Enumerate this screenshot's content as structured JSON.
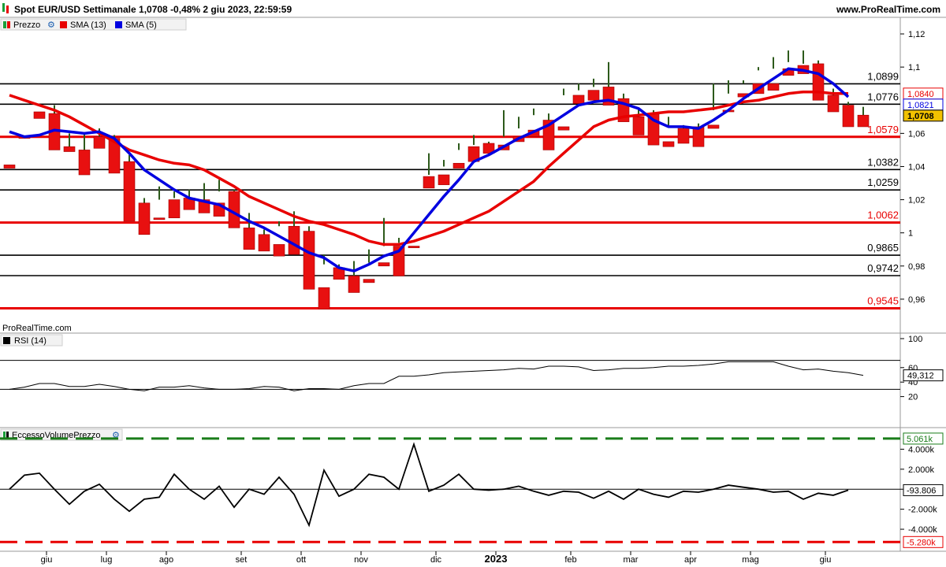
{
  "header": {
    "title": "Spot EUR/USD Settimanale 1,0708 -0,48% 2 giu 2023, 22:59:59",
    "site": "www.ProRealTime.com"
  },
  "price_panel": {
    "legend": [
      {
        "label": "Prezzo",
        "color": "#1a9e3a",
        "icon": "candles-icon"
      },
      {
        "label": "SMA (13)",
        "color": "#e80000"
      },
      {
        "label": "SMA (5)",
        "color": "#0000e0"
      }
    ],
    "watermark": "ProRealTime.com",
    "price_badges": [
      {
        "text": "1,0840",
        "value": 1.084,
        "color": "#e80000"
      },
      {
        "text": "1,0821",
        "value": 1.0821,
        "color": "#0000e0"
      },
      {
        "text": "1,0708",
        "value": 1.0708,
        "color": "#000000",
        "fill": "#f2c200"
      }
    ]
  },
  "rsi_panel": {
    "title": "RSI (14)",
    "value_label": "49,312",
    "value": 49.312,
    "levels": [
      70,
      30
    ],
    "axis": {
      "ticks": [
        20,
        40,
        60,
        100
      ],
      "labels": [
        "20",
        "40",
        "60",
        "100"
      ]
    },
    "series": [
      30,
      33,
      38,
      38,
      34,
      34,
      37,
      34,
      30,
      28,
      33,
      33,
      35,
      32,
      30,
      30,
      31,
      34,
      33,
      28,
      31,
      31,
      30,
      35,
      38,
      38,
      48,
      48,
      50,
      53,
      54,
      55,
      56,
      57,
      59,
      58,
      62,
      62,
      61,
      56,
      57,
      59,
      59,
      60,
      62,
      62,
      63,
      65,
      68,
      68,
      68,
      68,
      62,
      57,
      58,
      55,
      53,
      49.3
    ]
  },
  "volume_panel": {
    "title": "EccessoVolumePrezzo",
    "labels": {
      "top": "5.061k",
      "bottom": "-5.280k",
      "current": "-93.806"
    },
    "levels": {
      "top": 5061,
      "bottom": -5280
    },
    "axis": {
      "ticks": [
        4000,
        2000,
        0,
        -2000,
        -4000
      ],
      "labels": [
        "4.000k",
        "2.000k",
        "0",
        "-2.000k",
        "-4.000k"
      ]
    },
    "series": [
      0,
      1400,
      1600,
      0,
      -1500,
      -200,
      500,
      -1000,
      -2200,
      -1000,
      -800,
      1500,
      0,
      -1000,
      300,
      -1800,
      0,
      -500,
      1200,
      -500,
      -3600,
      1900,
      -700,
      0,
      1500,
      1200,
      0,
      4500,
      -200,
      400,
      1500,
      0,
      -100,
      0,
      300,
      -200,
      -600,
      -200,
      -300,
      -900,
      -200,
      -1000,
      0,
      -500,
      -800,
      -200,
      -300,
      0,
      400,
      200,
      0,
      -300,
      -200,
      -1000,
      -400,
      -600,
      -94
    ]
  },
  "chart_data": {
    "type": "candlestick",
    "title": "Spot EUR/USD Settimanale 1,0708 -0,48% 2 giu 2023, 22:59:59",
    "timeframe": "Settimanale",
    "instrument": "Spot EUR/USD",
    "last": 1.0708,
    "change": "-0,48%",
    "ylim": [
      0.94,
      1.13
    ],
    "y_ticks": [
      0.96,
      0.98,
      1.0,
      1.02,
      1.04,
      1.06,
      1.1,
      1.12
    ],
    "y_tick_labels": [
      "0,96",
      "0,98",
      "1",
      "1,02",
      "1,04",
      "1,06",
      "1,1",
      "1,12"
    ],
    "x_month_labels": [
      {
        "label": "giu",
        "index": 2
      },
      {
        "label": "lug",
        "index": 6
      },
      {
        "label": "ago",
        "index": 10
      },
      {
        "label": "set",
        "index": 15
      },
      {
        "label": "ott",
        "index": 19
      },
      {
        "label": "nov",
        "index": 23
      },
      {
        "label": "dic",
        "index": 28
      },
      {
        "label": "2023",
        "index": 32
      },
      {
        "label": "feb",
        "index": 37
      },
      {
        "label": "mar",
        "index": 41
      },
      {
        "label": "apr",
        "index": 45
      },
      {
        "label": "mag",
        "index": 49
      },
      {
        "label": "giu",
        "index": 54
      }
    ],
    "horizontal_levels": [
      {
        "value": 1.0899,
        "label": "1,0899",
        "color": "#000000"
      },
      {
        "value": 1.0776,
        "label": "1,0776",
        "color": "#000000"
      },
      {
        "value": 1.0579,
        "label": "1,0579",
        "color": "#e80000"
      },
      {
        "value": 1.0382,
        "label": "1,0382",
        "color": "#000000"
      },
      {
        "value": 1.0259,
        "label": "1,0259",
        "color": "#000000"
      },
      {
        "value": 1.0062,
        "label": "1,0062",
        "color": "#e80000"
      },
      {
        "value": 0.9865,
        "label": "0,9865",
        "color": "#000000"
      },
      {
        "value": 0.9742,
        "label": "0,9742",
        "color": "#000000"
      },
      {
        "value": 0.9545,
        "label": "0,9545",
        "color": "#e80000"
      }
    ],
    "candles": [
      [
        1.041,
        1.06,
        1.06,
        1.039
      ],
      [
        1.058,
        1.075,
        1.075,
        1.057
      ],
      [
        1.073,
        1.078,
        1.078,
        1.069
      ],
      [
        1.072,
        1.077,
        1.052,
        1.05
      ],
      [
        1.052,
        1.06,
        1.05,
        1.049
      ],
      [
        1.05,
        1.06,
        1.036,
        1.035
      ],
      [
        1.058,
        1.063,
        1.056,
        1.051
      ],
      [
        1.057,
        1.059,
        1.043,
        1.036
      ],
      [
        1.043,
        1.047,
        1.017,
        1.007
      ],
      [
        1.018,
        1.021,
        1.009,
        0.999
      ],
      [
        1.009,
        1.028,
        1.02,
        1.008
      ],
      [
        1.02,
        1.025,
        1.021,
        1.009
      ],
      [
        1.021,
        1.026,
        1.02,
        1.014
      ],
      [
        1.02,
        1.03,
        1.017,
        1.012
      ],
      [
        1.018,
        1.032,
        1.025,
        1.01
      ],
      [
        1.025,
        1.026,
        1.004,
        1.003
      ],
      [
        1.003,
        1.012,
        0.999,
        0.99
      ],
      [
        0.999,
        1.002,
        0.994,
        0.989
      ],
      [
        0.993,
        1.007,
        1.004,
        0.986
      ],
      [
        1.004,
        1.013,
        0.994,
        0.987
      ],
      [
        1.001,
        1.004,
        0.967,
        0.966
      ],
      [
        0.967,
        0.987,
        0.981,
        0.954
      ],
      [
        0.979,
        0.981,
        0.974,
        0.972
      ],
      [
        0.974,
        0.983,
        0.972,
        0.964
      ],
      [
        0.972,
        0.99,
        0.982,
        0.97
      ],
      [
        0.982,
        1.009,
        0.992,
        0.98
      ],
      [
        0.992,
        0.997,
        0.994,
        0.974
      ],
      [
        0.992,
        1.035,
        1.035,
        0.991
      ],
      [
        1.034,
        1.048,
        1.035,
        1.027
      ],
      [
        1.035,
        1.044,
        1.04,
        1.029
      ],
      [
        1.042,
        1.054,
        1.05,
        1.039
      ],
      [
        1.052,
        1.059,
        1.053,
        1.043
      ],
      [
        1.054,
        1.055,
        1.053,
        1.048
      ],
      [
        1.053,
        1.074,
        1.058,
        1.05
      ],
      [
        1.058,
        1.07,
        1.063,
        1.055
      ],
      [
        1.062,
        1.075,
        1.071,
        1.058
      ],
      [
        1.068,
        1.072,
        1.064,
        1.05
      ],
      [
        1.064,
        1.087,
        1.083,
        1.062
      ],
      [
        1.083,
        1.09,
        1.086,
        1.078
      ],
      [
        1.086,
        1.093,
        1.088,
        1.08
      ],
      [
        1.088,
        1.103,
        1.081,
        1.077
      ],
      [
        1.081,
        1.084,
        1.07,
        1.067
      ],
      [
        1.07,
        1.075,
        1.068,
        1.059
      ],
      [
        1.072,
        1.074,
        1.054,
        1.053
      ],
      [
        1.055,
        1.07,
        1.064,
        1.052
      ],
      [
        1.063,
        1.065,
        1.061,
        1.054
      ],
      [
        1.064,
        1.066,
        1.063,
        1.052
      ],
      [
        1.065,
        1.09,
        1.074,
        1.063
      ],
      [
        1.074,
        1.092,
        1.084,
        1.073
      ],
      [
        1.084,
        1.092,
        1.09,
        1.082
      ],
      [
        1.09,
        1.1,
        1.098,
        1.084
      ],
      [
        1.09,
        1.106,
        1.099,
        1.086
      ],
      [
        1.099,
        1.11,
        1.103,
        1.095
      ],
      [
        1.101,
        1.11,
        1.102,
        1.096
      ],
      [
        1.102,
        1.104,
        1.083,
        1.08
      ],
      [
        1.083,
        1.087,
        1.077,
        1.073
      ],
      [
        1.077,
        1.079,
        1.07,
        1.064
      ],
      [
        1.071,
        1.076,
        1.071,
        1.064
      ]
    ],
    "series": [
      {
        "name": "SMA (13)",
        "color": "#e80000",
        "values": [
          1.083,
          1.08,
          1.077,
          1.074,
          1.07,
          1.065,
          1.06,
          1.055,
          1.05,
          1.047,
          1.044,
          1.042,
          1.041,
          1.038,
          1.033,
          1.028,
          1.022,
          1.018,
          1.014,
          1.01,
          1.007,
          1.005,
          1.002,
          0.999,
          0.995,
          0.993,
          0.993,
          0.995,
          0.998,
          1.001,
          1.005,
          1.009,
          1.013,
          1.019,
          1.025,
          1.031,
          1.04,
          1.048,
          1.056,
          1.064,
          1.068,
          1.07,
          1.071,
          1.072,
          1.073,
          1.073,
          1.074,
          1.075,
          1.077,
          1.079,
          1.08,
          1.082,
          1.084,
          1.085,
          1.085,
          1.084,
          1.084
        ]
      },
      {
        "name": "SMA (5)",
        "color": "#0000e0",
        "values": [
          1.061,
          1.058,
          1.059,
          1.062,
          1.061,
          1.06,
          1.061,
          1.057,
          1.048,
          1.038,
          1.032,
          1.026,
          1.021,
          1.019,
          1.017,
          1.012,
          1.007,
          1.003,
          0.998,
          0.993,
          0.988,
          0.985,
          0.979,
          0.977,
          0.981,
          0.986,
          0.989,
          1.0,
          1.011,
          1.022,
          1.032,
          1.043,
          1.047,
          1.052,
          1.057,
          1.061,
          1.065,
          1.071,
          1.077,
          1.079,
          1.08,
          1.078,
          1.075,
          1.068,
          1.064,
          1.064,
          1.063,
          1.068,
          1.074,
          1.081,
          1.087,
          1.093,
          1.099,
          1.098,
          1.096,
          1.09,
          1.082
        ]
      }
    ]
  }
}
